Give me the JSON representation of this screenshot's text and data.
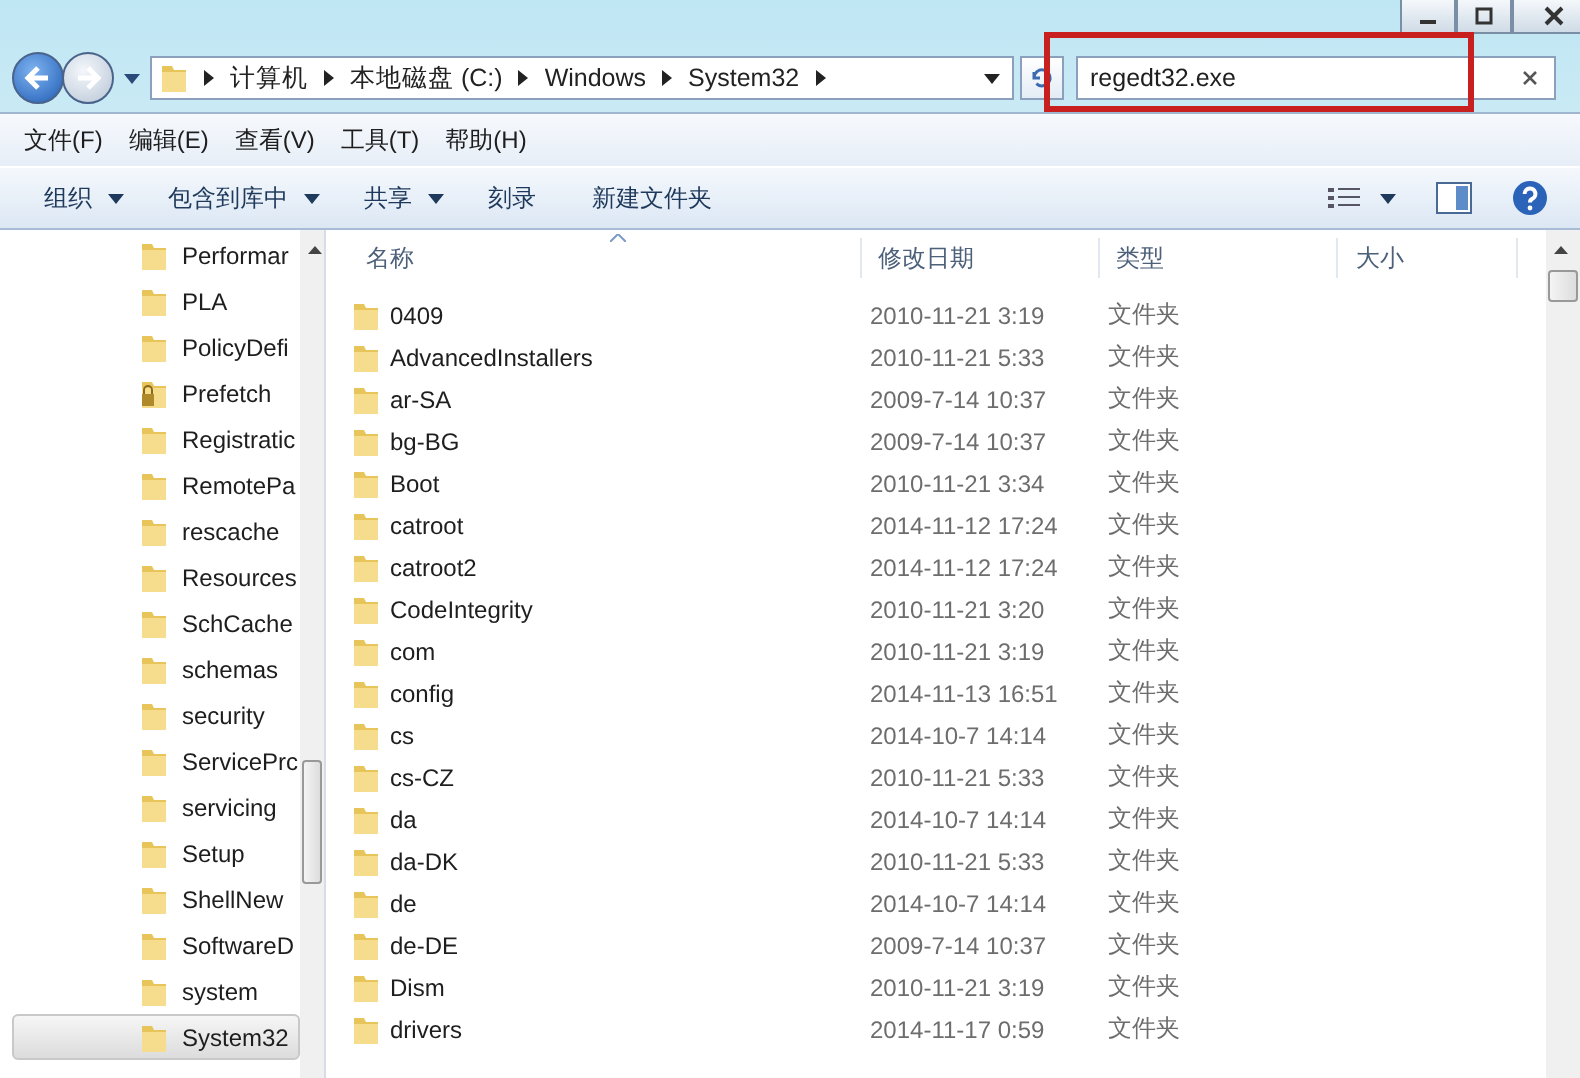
{
  "address": {
    "crumbs": [
      "计算机",
      "本地磁盘 (C:)",
      "Windows",
      "System32"
    ]
  },
  "search": {
    "value": "regedt32.exe"
  },
  "menu": [
    "文件(F)",
    "编辑(E)",
    "查看(V)",
    "工具(T)",
    "帮助(H)"
  ],
  "toolbar": [
    {
      "label": "组织",
      "has_menu": true
    },
    {
      "label": "包含到库中",
      "has_menu": true
    },
    {
      "label": "共享",
      "has_menu": true
    },
    {
      "label": "刻录",
      "has_menu": false
    },
    {
      "label": "新建文件夹",
      "has_menu": false
    }
  ],
  "sidebar": {
    "items": [
      {
        "label": "Performar",
        "kind": "folder",
        "selected": false
      },
      {
        "label": "PLA",
        "kind": "folder",
        "selected": false
      },
      {
        "label": "PolicyDefi",
        "kind": "folder",
        "selected": false
      },
      {
        "label": "Prefetch",
        "kind": "locked-folder",
        "selected": false
      },
      {
        "label": "Registratic",
        "kind": "folder",
        "selected": false
      },
      {
        "label": "RemotePa",
        "kind": "folder",
        "selected": false
      },
      {
        "label": "rescache",
        "kind": "folder",
        "selected": false
      },
      {
        "label": "Resources",
        "kind": "folder",
        "selected": false
      },
      {
        "label": "SchCache",
        "kind": "folder",
        "selected": false
      },
      {
        "label": "schemas",
        "kind": "folder",
        "selected": false
      },
      {
        "label": "security",
        "kind": "folder",
        "selected": false
      },
      {
        "label": "ServicePrc",
        "kind": "folder",
        "selected": false
      },
      {
        "label": "servicing",
        "kind": "folder",
        "selected": false
      },
      {
        "label": "Setup",
        "kind": "folder",
        "selected": false
      },
      {
        "label": "ShellNew",
        "kind": "folder",
        "selected": false
      },
      {
        "label": "SoftwareD",
        "kind": "folder",
        "selected": false
      },
      {
        "label": "system",
        "kind": "folder",
        "selected": false
      },
      {
        "label": "System32",
        "kind": "folder",
        "selected": true
      }
    ]
  },
  "table": {
    "columns": [
      "名称",
      "修改日期",
      "类型",
      "大小"
    ],
    "rows": [
      {
        "name": "0409",
        "date": "2010-11-21 3:19",
        "type": "文件夹"
      },
      {
        "name": "AdvancedInstallers",
        "date": "2010-11-21 5:33",
        "type": "文件夹"
      },
      {
        "name": "ar-SA",
        "date": "2009-7-14 10:37",
        "type": "文件夹"
      },
      {
        "name": "bg-BG",
        "date": "2009-7-14 10:37",
        "type": "文件夹"
      },
      {
        "name": "Boot",
        "date": "2010-11-21 3:34",
        "type": "文件夹"
      },
      {
        "name": "catroot",
        "date": "2014-11-12 17:24",
        "type": "文件夹"
      },
      {
        "name": "catroot2",
        "date": "2014-11-12 17:24",
        "type": "文件夹"
      },
      {
        "name": "CodeIntegrity",
        "date": "2010-11-21 3:20",
        "type": "文件夹"
      },
      {
        "name": "com",
        "date": "2010-11-21 3:19",
        "type": "文件夹"
      },
      {
        "name": "config",
        "date": "2014-11-13 16:51",
        "type": "文件夹"
      },
      {
        "name": "cs",
        "date": "2014-10-7 14:14",
        "type": "文件夹"
      },
      {
        "name": "cs-CZ",
        "date": "2010-11-21 5:33",
        "type": "文件夹"
      },
      {
        "name": "da",
        "date": "2014-10-7 14:14",
        "type": "文件夹"
      },
      {
        "name": "da-DK",
        "date": "2010-11-21 5:33",
        "type": "文件夹"
      },
      {
        "name": "de",
        "date": "2014-10-7 14:14",
        "type": "文件夹"
      },
      {
        "name": "de-DE",
        "date": "2009-7-14 10:37",
        "type": "文件夹"
      },
      {
        "name": "Dism",
        "date": "2010-11-21 3:19",
        "type": "文件夹"
      },
      {
        "name": "drivers",
        "date": "2014-11-17 0:59",
        "type": "文件夹"
      }
    ]
  }
}
